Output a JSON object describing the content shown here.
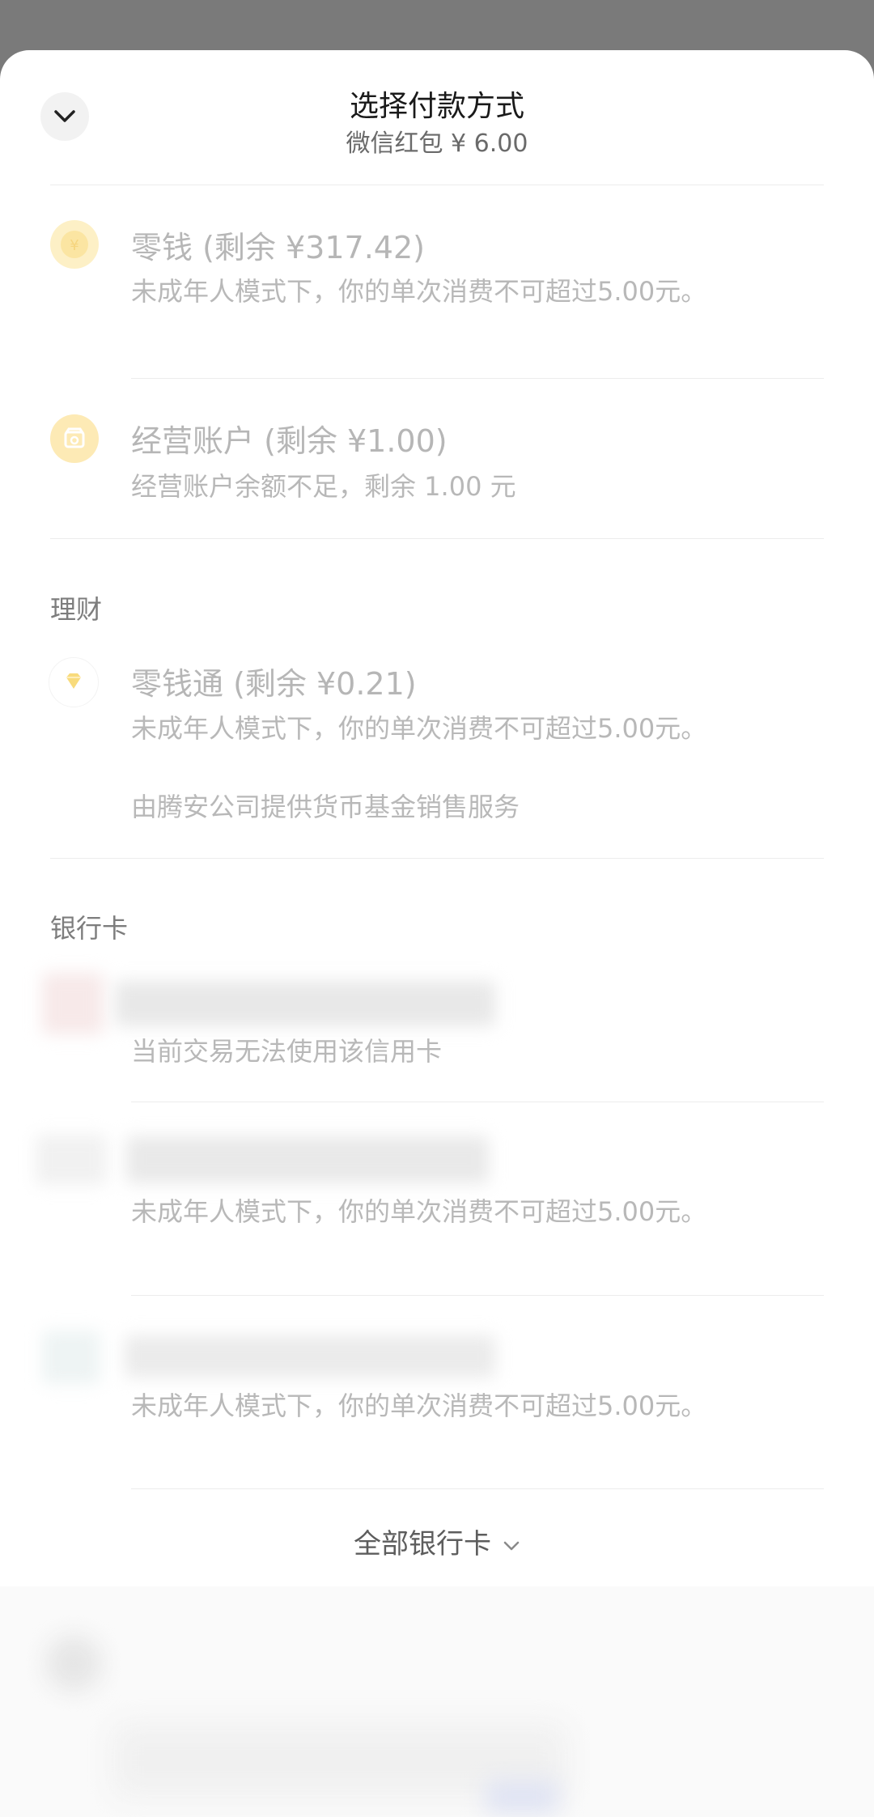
{
  "header": {
    "title": "选择付款方式",
    "subtitle": "微信红包 ¥ 6.00"
  },
  "wallet": {
    "change": {
      "title": "零钱 (剩余 ¥317.42)",
      "desc": "未成年人模式下，你的单次消费不可超过5.00元。"
    },
    "business": {
      "title": "经营账户 (剩余 ¥1.00)",
      "desc": "经营账户余额不足，剩余 1.00 元"
    }
  },
  "wealth": {
    "label": "理财",
    "lingqiantong": {
      "title": "零钱通 (剩余 ¥0.21)",
      "desc": "未成年人模式下，你的单次消费不可超过5.00元。",
      "note": "由腾安公司提供货币基金销售服务"
    }
  },
  "bank_cards": {
    "label": "银行卡",
    "items": [
      {
        "desc": "当前交易无法使用该信用卡"
      },
      {
        "desc": "未成年人模式下，你的单次消费不可超过5.00元。"
      },
      {
        "desc": "未成年人模式下，你的单次消费不可超过5.00元。"
      }
    ],
    "all_label": "全部银行卡"
  },
  "colors": {
    "overlay": "#7a7a7a",
    "coin_yellow": "#fbe6a6",
    "text_disabled": "#b6b6b6"
  },
  "icons": {
    "collapse": "chevron-down-icon",
    "change": "coin-icon",
    "business": "store-icon",
    "lingqiantong": "diamond-icon"
  }
}
